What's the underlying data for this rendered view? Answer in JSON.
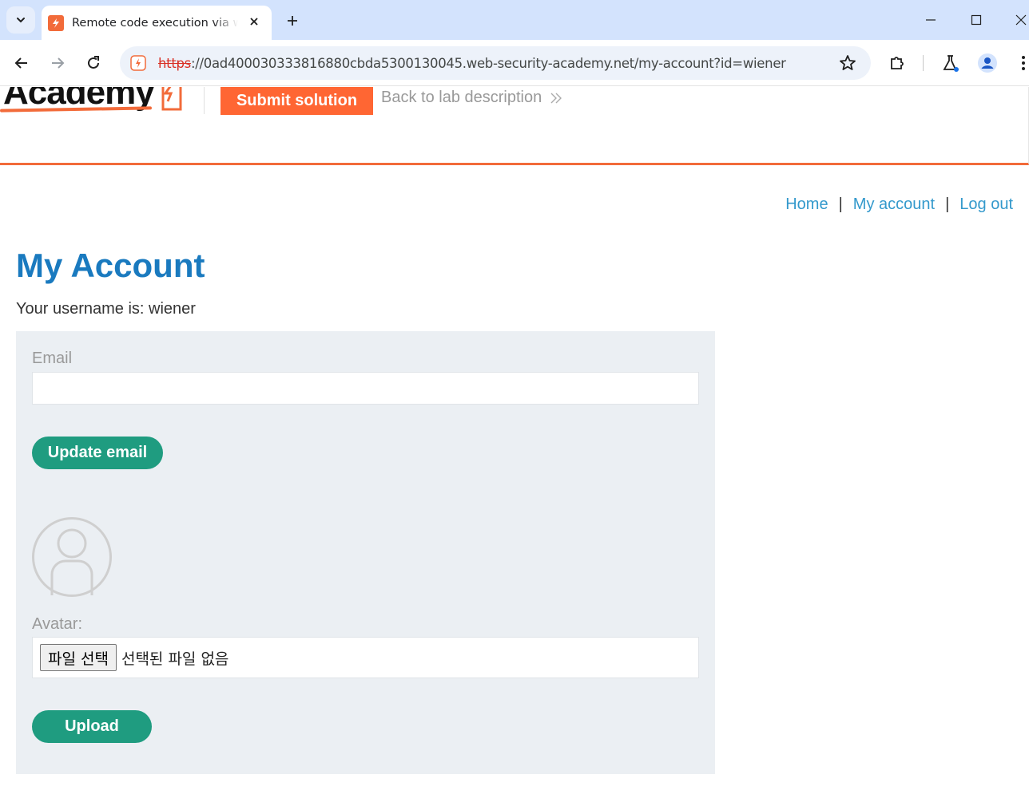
{
  "browser": {
    "tab_title": "Remote code execution via web shell upload",
    "url_scheme": "https",
    "url_rest": "://0ad400030333816880cbda5300130045.web-security-academy.net/my-account?id=wiener",
    "accent": "#d3e3fd"
  },
  "lab_header": {
    "logo_text": "Academy",
    "submit_label": "Submit solution",
    "back_label": "Back to lab description",
    "accent": "#ff6633"
  },
  "nav": {
    "home": "Home",
    "my_account": "My account",
    "log_out": "Log out",
    "separator": "|"
  },
  "account": {
    "title": "My Account",
    "username_text": "Your username is: wiener",
    "email_label": "Email",
    "email_value": "",
    "update_email_label": "Update email",
    "avatar_label": "Avatar:",
    "file_button_label": "파일 선택",
    "file_status": "선택된 파일 없음",
    "upload_label": "Upload",
    "button_color": "#1f9c80",
    "title_color": "#1a7abf",
    "link_color": "#3399cc"
  },
  "icons": [
    "chevron-down-icon",
    "close-icon",
    "plus-icon",
    "minimize-icon",
    "maximize-icon",
    "back-arrow-icon",
    "forward-arrow-icon",
    "reload-icon",
    "star-icon",
    "extensions-icon",
    "labs-flask-icon",
    "profile-icon",
    "more-vert-icon",
    "avatar-placeholder-icon",
    "double-chevron-right-icon"
  ]
}
